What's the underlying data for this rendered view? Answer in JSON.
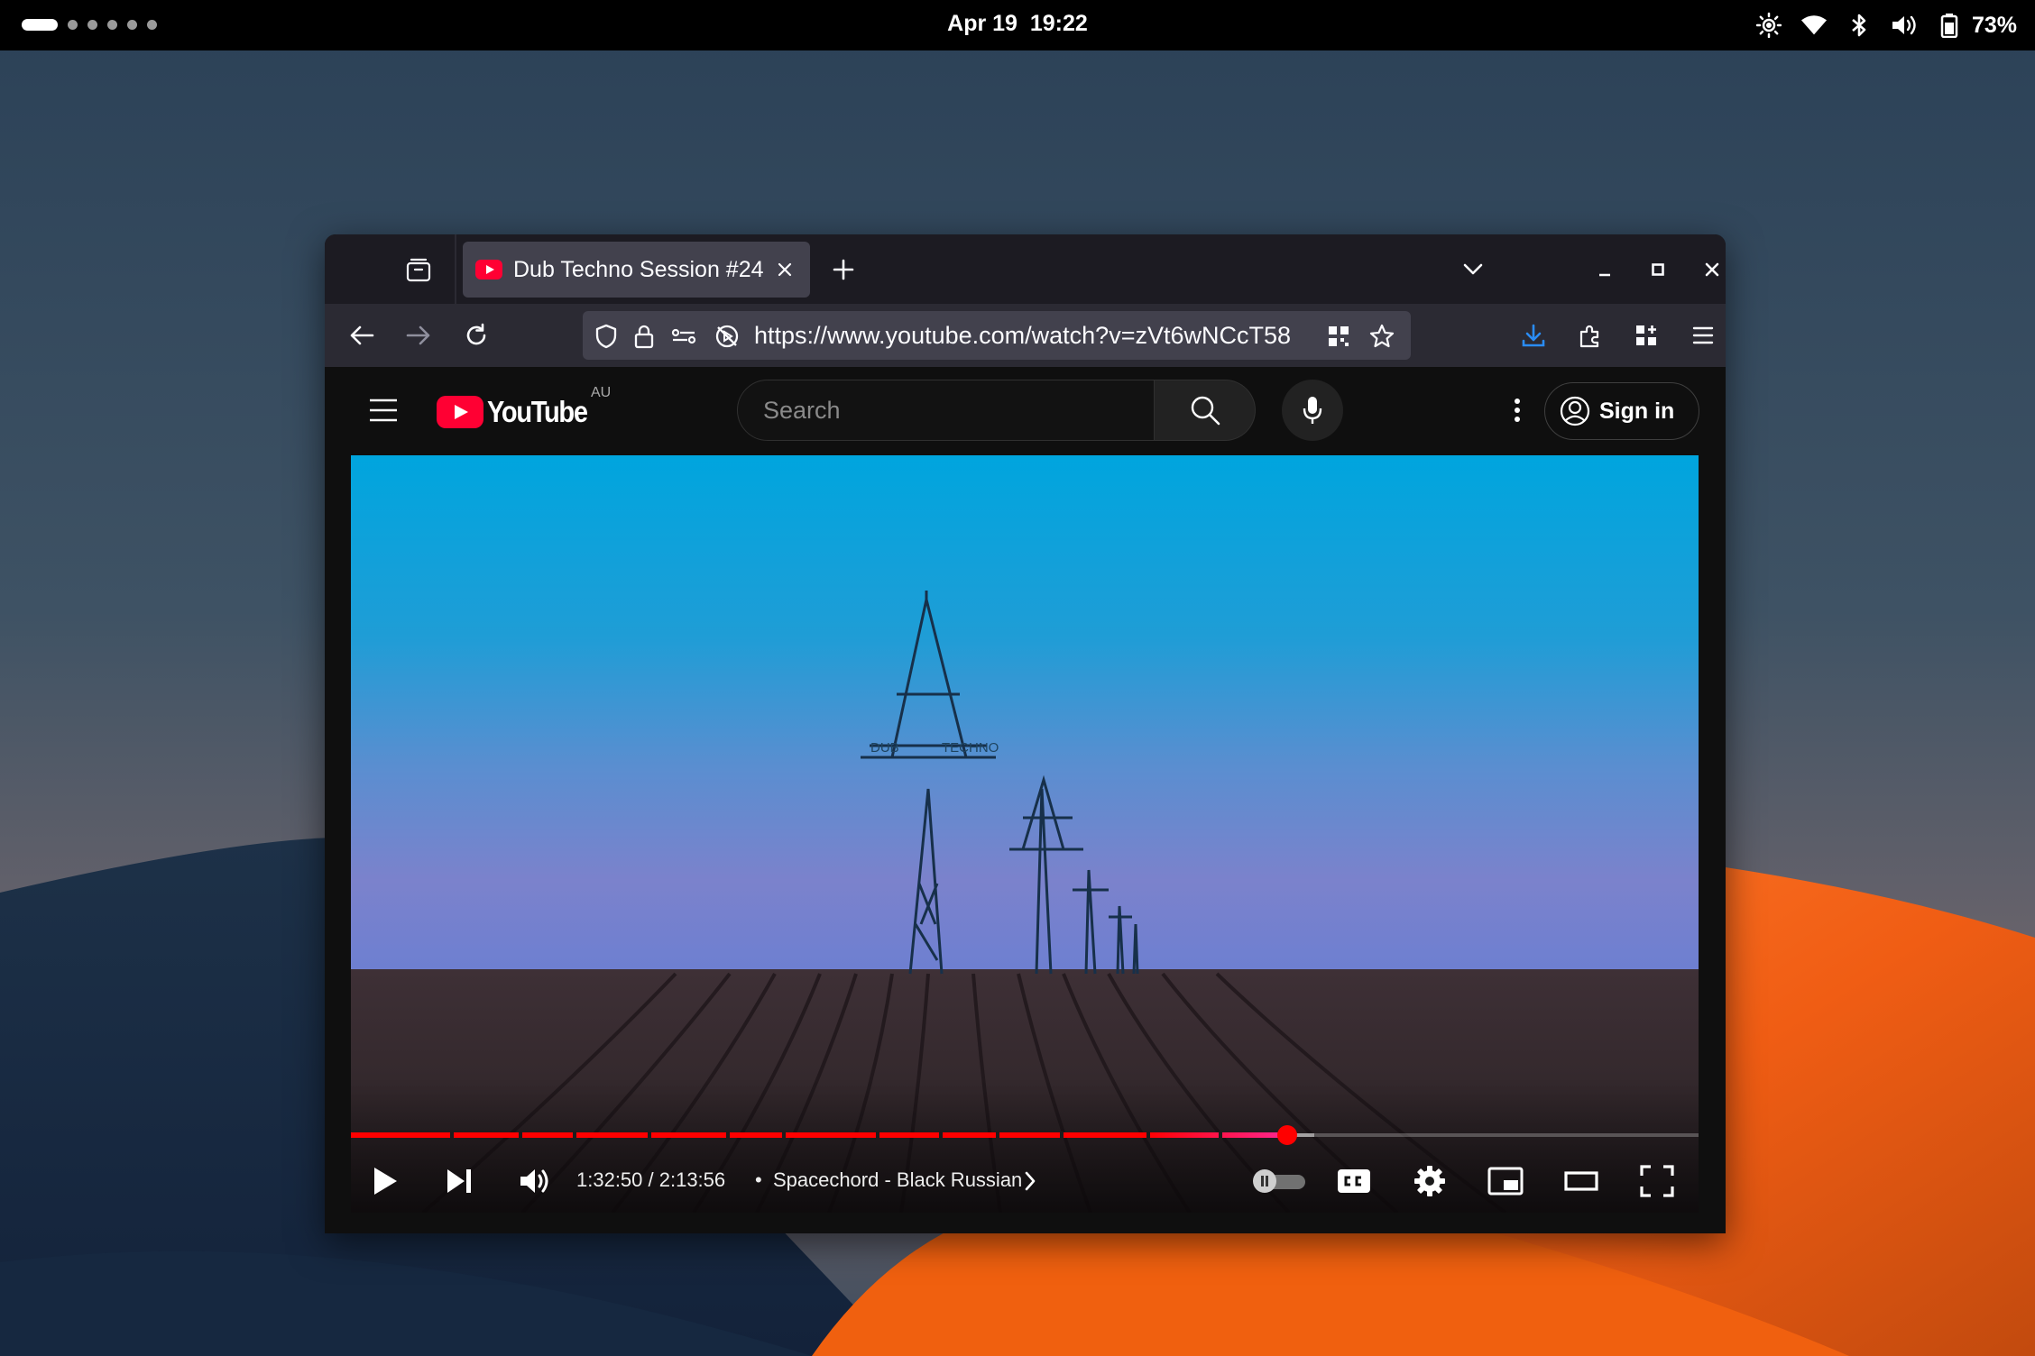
{
  "system": {
    "date": "Apr 19",
    "time": "19:22",
    "battery_percent": "73%",
    "workspace_count": 6,
    "active_workspace": 1
  },
  "browser": {
    "tab": {
      "title": "Dub Techno Session #24",
      "favicon": "youtube-favicon"
    },
    "url": "https://www.youtube.com/watch?v=zVt6wNCcT58",
    "accent_color": "#2a8cf5"
  },
  "youtube": {
    "logo_text": "YouTube",
    "region": "AU",
    "search_placeholder": "Search",
    "sign_in_label": "Sign in"
  },
  "player": {
    "current_time": "1:32:50",
    "duration": "2:13:56",
    "time_display": "1:32:50 / 2:13:56",
    "chapter_separator": "•",
    "chapter_title": "Spacechord - Black Russian",
    "progress_fraction": 0.693,
    "buffered_fraction": 0.713,
    "chapter_marks": [
      0.08,
      0.13,
      0.17,
      0.225,
      0.282,
      0.323,
      0.392,
      0.438,
      0.48,
      0.527,
      0.59,
      0.643
    ],
    "autoplay_on": false,
    "video_overlay_text": [
      "DUB",
      "TECHNO"
    ],
    "colors": {
      "played": "#ff0000",
      "end": "#ff2791"
    }
  }
}
